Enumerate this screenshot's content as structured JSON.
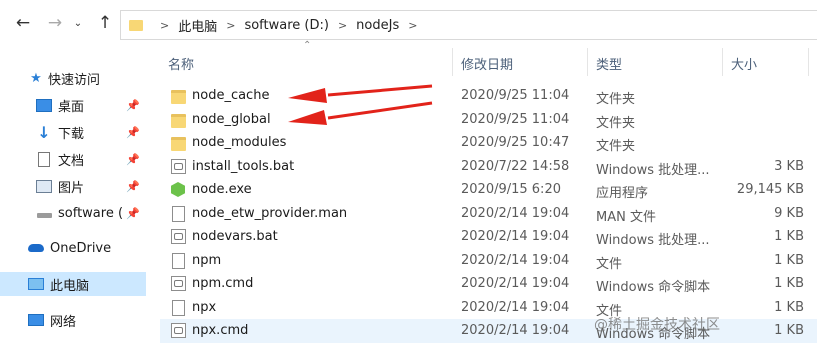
{
  "path": [
    "此电脑",
    "software (D:)",
    "nodeJs"
  ],
  "nav": {
    "quick_access": "快速访问",
    "items": [
      "桌面",
      "下载",
      "文档",
      "图片",
      "software ("
    ],
    "onedrive": "OneDrive",
    "this_pc": "此电脑",
    "network": "网络"
  },
  "columns": {
    "name": "名称",
    "date": "修改日期",
    "type": "类型",
    "size": "大小"
  },
  "files": [
    {
      "name": "node_cache",
      "date": "2020/9/25 11:04",
      "type": "文件夹",
      "size": "",
      "icon": "folder"
    },
    {
      "name": "node_global",
      "date": "2020/9/25 11:04",
      "type": "文件夹",
      "size": "",
      "icon": "folder"
    },
    {
      "name": "node_modules",
      "date": "2020/9/25 10:47",
      "type": "文件夹",
      "size": "",
      "icon": "folder"
    },
    {
      "name": "install_tools.bat",
      "date": "2020/7/22 14:58",
      "type": "Windows 批处理...",
      "size": "3 KB",
      "icon": "bat"
    },
    {
      "name": "node.exe",
      "date": "2020/9/15 6:20",
      "type": "应用程序",
      "size": "29,145 KB",
      "icon": "node"
    },
    {
      "name": "node_etw_provider.man",
      "date": "2020/2/14 19:04",
      "type": "MAN 文件",
      "size": "9 KB",
      "icon": "file"
    },
    {
      "name": "nodevars.bat",
      "date": "2020/2/14 19:04",
      "type": "Windows 批处理...",
      "size": "1 KB",
      "icon": "bat"
    },
    {
      "name": "npm",
      "date": "2020/2/14 19:04",
      "type": "文件",
      "size": "1 KB",
      "icon": "file"
    },
    {
      "name": "npm.cmd",
      "date": "2020/2/14 19:04",
      "type": "Windows 命令脚本",
      "size": "1 KB",
      "icon": "bat"
    },
    {
      "name": "npx",
      "date": "2020/2/14 19:04",
      "type": "文件",
      "size": "1 KB",
      "icon": "file"
    },
    {
      "name": "npx.cmd",
      "date": "2020/2/14 19:04",
      "type": "Windows 命令脚本",
      "size": "1 KB",
      "icon": "bat"
    }
  ],
  "watermark": "@稀土掘金技术社区"
}
